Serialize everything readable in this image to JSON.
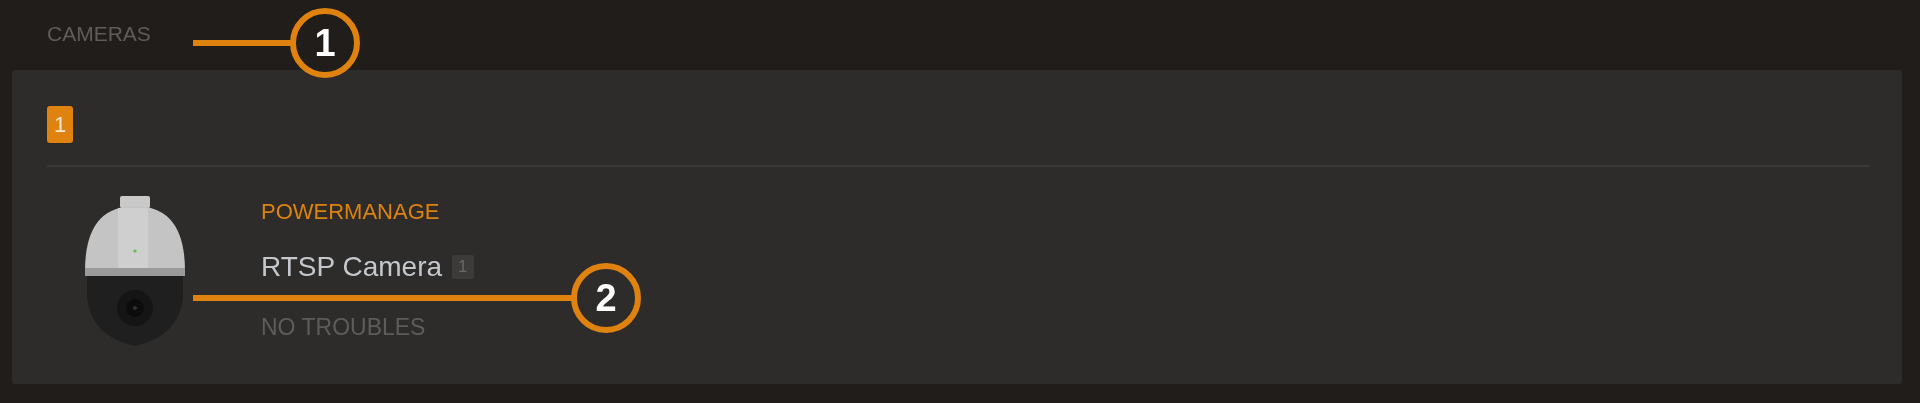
{
  "section": {
    "title": "CAMERAS"
  },
  "group": {
    "number": "1"
  },
  "devices": [
    {
      "kind": "camera",
      "partition": "POWERMANAGE",
      "name": "RTSP Camera",
      "zone": "1",
      "status": "NO TROUBLES"
    }
  ],
  "callouts": [
    {
      "label": "1",
      "kind": "section"
    },
    {
      "label": "2",
      "kind": "device"
    }
  ]
}
